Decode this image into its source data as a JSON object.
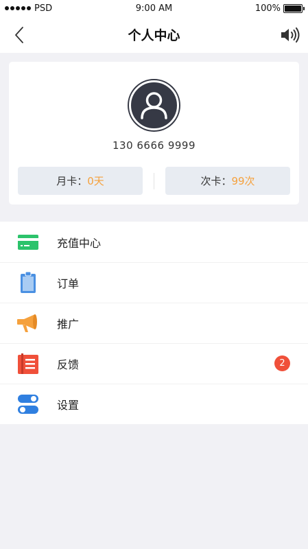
{
  "status_bar": {
    "carrier": "PSD",
    "time": "9:00 AM",
    "battery_percent": "100%",
    "battery_level": 1.0
  },
  "nav": {
    "title": "个人中心",
    "back_icon": "chevron-left-icon",
    "right_icon": "speaker-icon"
  },
  "profile": {
    "phone": "130 6666 9999",
    "month_card_label": "月卡：",
    "month_card_value": "0天",
    "count_card_label": "次卡：",
    "count_card_value": "99次"
  },
  "menu": {
    "items": [
      {
        "label": "充值中心",
        "icon": "card-icon",
        "color": "#2cc36b"
      },
      {
        "label": "订单",
        "icon": "clipboard-icon",
        "color": "#4a90e2"
      },
      {
        "label": "推广",
        "icon": "megaphone-icon",
        "color": "#f5a13d"
      },
      {
        "label": "反馈",
        "icon": "feedback-icon",
        "color": "#f0503a",
        "badge": "2"
      },
      {
        "label": "设置",
        "icon": "toggle-icon",
        "color": "#2f7fe0"
      }
    ]
  },
  "colors": {
    "accent_orange": "#f5a13d",
    "badge_red": "#f0503a",
    "avatar_dark": "#363945",
    "background": "#f1f1f5"
  }
}
